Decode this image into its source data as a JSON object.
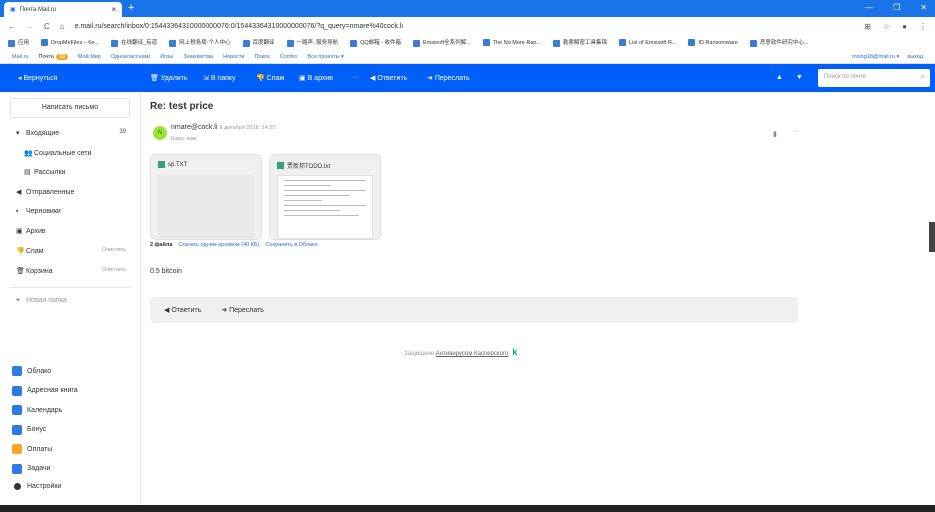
{
  "browser": {
    "tab_title": "Почта Mail.ru",
    "url": "e.mail.ru/search/inbox/0:15443364310000000076:0/15443364310000000076/?q_query=nmare%40cock.li",
    "bookmarks": [
      "应用",
      "DropMeFiles – бe...",
      "在线翻译_有道",
      "网上税务局-个人中心",
      "百度翻译",
      "一路声: 服务导航",
      "QQ邮箱 - 收件箱",
      "Emsisoft全系列解...",
      "The No More Ran...",
      "勒索解密工具集锦",
      "List of Emsisoft R...",
      "ID Ransomware",
      "恶意软件研究中心..."
    ]
  },
  "mailnav": {
    "items": [
      "Mail.ru",
      "Почта",
      "Мой Мир",
      "Одноклассники",
      "Игры",
      "Знакомства",
      "Новости",
      "Поиск",
      "Combo",
      "Все проекты ▾"
    ],
    "badge": "39",
    "user": "msing18@mail.ru ▾",
    "logout": "выход"
  },
  "toolbar": {
    "back": "Вернуться",
    "delete": "Удалить",
    "folder": "В папку",
    "spam": "Спам",
    "archive": "В архив",
    "more": "···",
    "reply": "Ответить",
    "forward": "Переслать",
    "search_placeholder": "Поиск по почте"
  },
  "sidebar": {
    "compose": "Написать письмо",
    "folders": [
      {
        "label": "Входящие",
        "count": "39"
      },
      {
        "label": "Социальные сети"
      },
      {
        "label": "Рассылки"
      },
      {
        "label": "Отправленные"
      },
      {
        "label": "Черновики"
      },
      {
        "label": "Архив"
      },
      {
        "label": "Спам",
        "action": "Очистить"
      },
      {
        "label": "Корзина",
        "action": "Очистить"
      }
    ],
    "new_folder": "Новая папка",
    "services": [
      "Облако",
      "Адресная книга",
      "Календарь",
      "Бонус",
      "Оплаты",
      "Задачи",
      "Настройки"
    ]
  },
  "message": {
    "subject": "Re: test price",
    "avatar": "N",
    "from": "nmare@cock.li",
    "date": "9 декабря 2018, 14:20",
    "to": "Кому: вам",
    "attachments": [
      {
        "name": "sp.TXT"
      },
      {
        "name": "贾新邦TODO.txt"
      }
    ],
    "files_count": "2 файла",
    "download": "Скачать одним архивом (40 КБ)",
    "save": "Сохранить в Облако",
    "body": "0.5 bitcoin",
    "reply": "Ответить",
    "forward": "Переслать"
  },
  "footer": {
    "protected": "Защищено",
    "antivirus": "Антивирусом Касперского",
    "logo": "k"
  }
}
